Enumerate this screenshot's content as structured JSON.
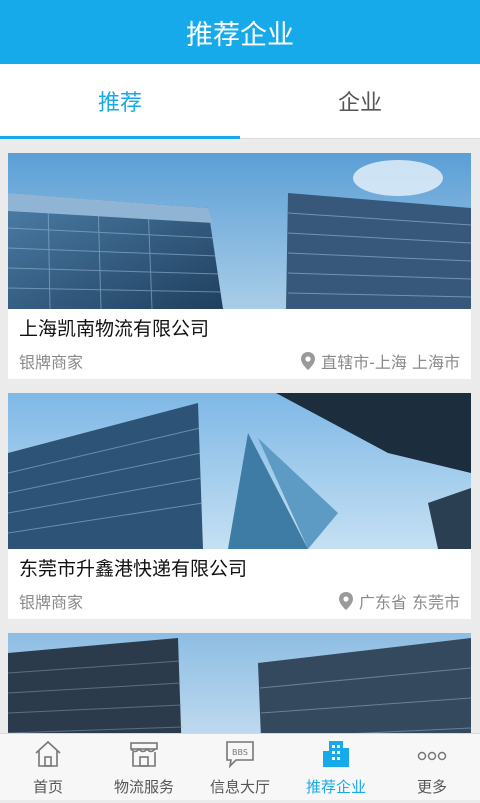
{
  "header": {
    "title": "推荐企业"
  },
  "tabs": [
    {
      "label": "推荐",
      "active": true
    },
    {
      "label": "企业",
      "active": false
    }
  ],
  "companies": [
    {
      "name": "上海凯南物流有限公司",
      "tier": "银牌商家",
      "location": "直辖市-上海 上海市"
    },
    {
      "name": "东莞市升鑫港快递有限公司",
      "tier": "银牌商家",
      "location": "广东省 东莞市"
    },
    {
      "name": "",
      "tier": "",
      "location": ""
    }
  ],
  "bottom_nav": [
    {
      "label": "首页",
      "icon": "home-icon",
      "active": false
    },
    {
      "label": "物流服务",
      "icon": "storefront-icon",
      "active": false
    },
    {
      "label": "信息大厅",
      "icon": "bbs-icon",
      "active": false
    },
    {
      "label": "推荐企业",
      "icon": "building-icon",
      "active": true
    },
    {
      "label": "更多",
      "icon": "more-icon",
      "active": false
    }
  ],
  "colors": {
    "accent": "#17aaeb",
    "background": "#ebebeb"
  }
}
